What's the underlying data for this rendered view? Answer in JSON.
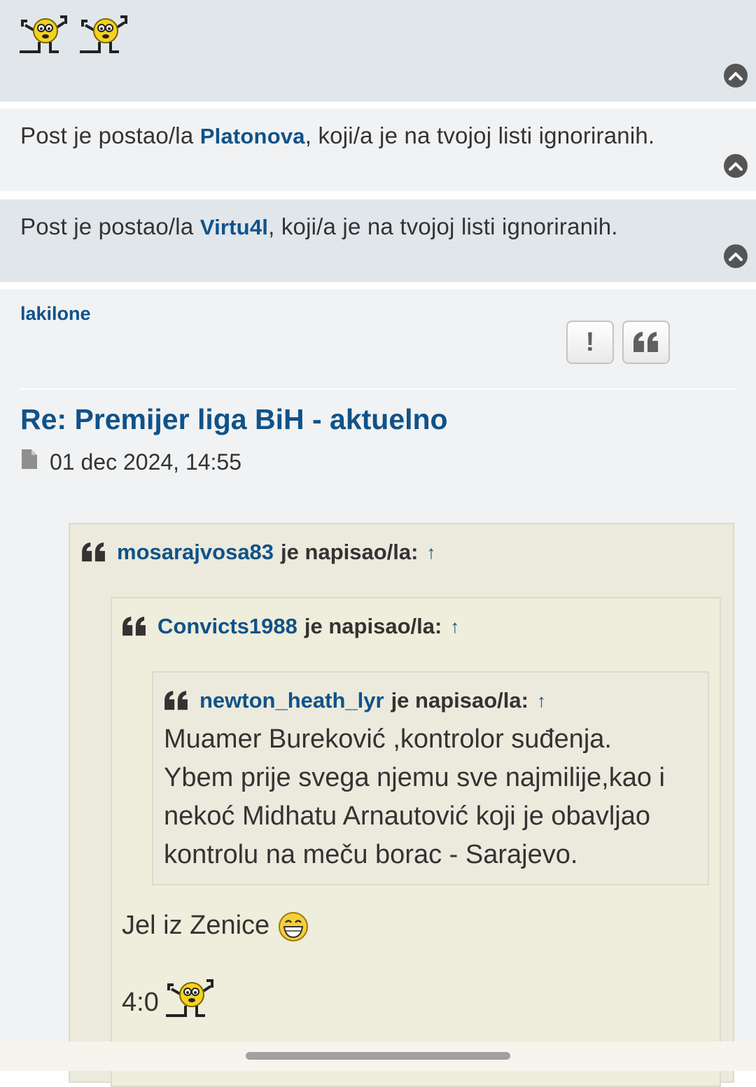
{
  "top_panel": {
    "smileys": [
      "dancing-smiley",
      "dancing-smiley"
    ]
  },
  "ignored_posts": [
    {
      "prefix": "Post je postao/la ",
      "user": "Platonova",
      "suffix": ", koji/a je na tvojoj listi ignoriranih."
    },
    {
      "prefix": "Post je postao/la ",
      "user": "Virtu4l",
      "suffix": ", koji/a je na tvojoj listi ignoriranih."
    }
  ],
  "post": {
    "author": "lakilone",
    "report_label": "!",
    "quote_label": "“",
    "title": "Re: Premijer liga BiH - aktuelno",
    "date": "01 dec 2024, 14:55",
    "quotes": [
      {
        "user": "mosarajvosa83",
        "wrote": "je napisao/la:",
        "arrow": "↑"
      },
      {
        "user": "Convicts1988",
        "wrote": "je napisao/la:",
        "arrow": "↑"
      },
      {
        "user": "newton_heath_lyr",
        "wrote": "je napisao/la:",
        "arrow": "↑",
        "lines": [
          "Muamer Bureković ,kontrolor suđenja.",
          "Ybem prije svega njemu sve najmilije,kao i",
          "nekoć Midhatu Arnautović koji je obavljao",
          "kontrolu na meču borac - Sarajevo."
        ]
      }
    ],
    "reply_lines": [
      "Jel iz Zenice",
      "4:0"
    ]
  },
  "colors": {
    "link": "#105289",
    "panel_blue": "#e1e6eb",
    "panel_grey": "#f1f2f3",
    "quote_bg": "#ebeadd",
    "text": "#333333"
  }
}
